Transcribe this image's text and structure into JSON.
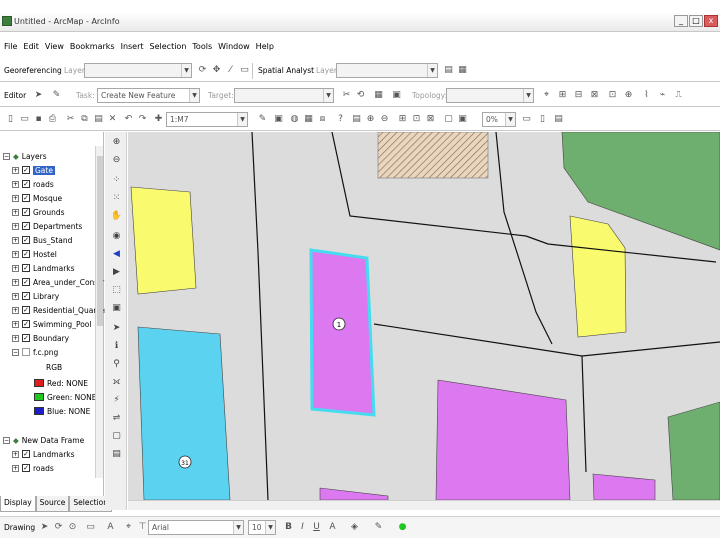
{
  "window": {
    "title": "Untitled - ArcMap - ArcInfo",
    "buttons": [
      "_",
      "□",
      "x"
    ]
  },
  "menu": [
    "File",
    "Edit",
    "View",
    "Bookmarks",
    "Insert",
    "Selection",
    "Tools",
    "Window",
    "Help"
  ],
  "toolbar_georef": {
    "label": "Georeferencing",
    "layer_label": "Layer:",
    "spatial_label": "Spatial Analyst",
    "spatial_layer_label": "Layer:"
  },
  "toolbar_editor": {
    "label": "Editor",
    "task_label": "Task:",
    "task_value": "Create New Feature",
    "target_label": "Target:",
    "topology_label": "Topology:"
  },
  "toolbar_standard": {
    "scale": "1:M7",
    "zoom": "0%"
  },
  "toc": {
    "root_label": "Layers",
    "layers": [
      "Gate",
      "roads",
      "Mosque",
      "Grounds",
      "Departments",
      "Bus_Stand",
      "Hostel",
      "Landmarks",
      "Area_under_Constr",
      "Library",
      "Residential_Quarter",
      "Swimming_Pool",
      "Boundary",
      "f.c.png"
    ],
    "raster_title": "RGB",
    "bands": [
      {
        "label": "Red:",
        "value": "NONE",
        "color": "#e01e1e"
      },
      {
        "label": "Green:",
        "value": "NONE",
        "color": "#1ec81e"
      },
      {
        "label": "Blue:",
        "value": "NONE",
        "color": "#1e1ec8"
      }
    ],
    "frame2_label": "New Data Frame",
    "frame2_layers": [
      "Landmarks",
      "roads"
    ],
    "tabs": [
      "Display",
      "Source",
      "Selection"
    ]
  },
  "map": {
    "colors": {
      "background": "#dcdcdc",
      "yellow": "#fafa6e",
      "magenta": "#dc78f0",
      "cyan": "#5ad2f0",
      "green": "#6eae6e",
      "outline_highlight": "#46dcf0"
    },
    "labels": [
      "1",
      "31"
    ]
  },
  "drawbar": {
    "label": "Drawing",
    "font": "Arial",
    "size": "10",
    "bold": "B",
    "italic": "I",
    "underline": "U"
  }
}
